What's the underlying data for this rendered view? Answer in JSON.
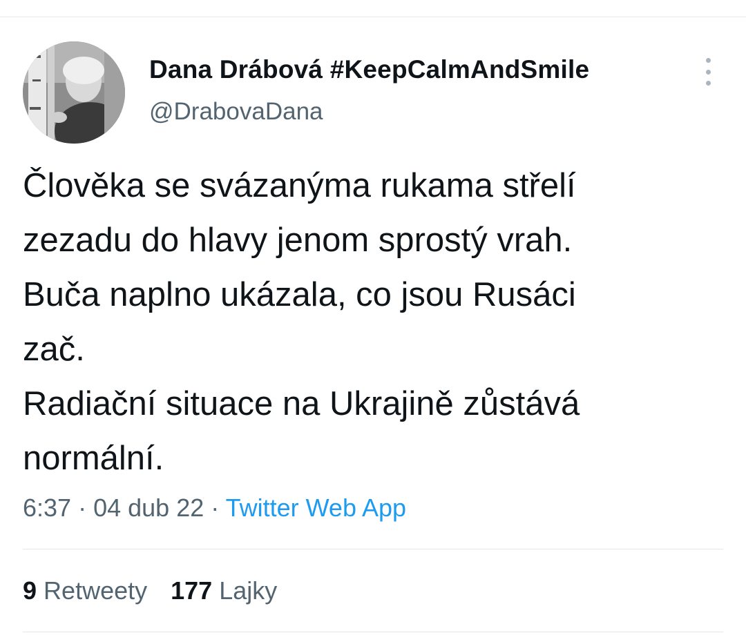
{
  "author": {
    "display_name": "Dana Drábová #KeepCalmAndSmile",
    "handle": "@DrabovaDana",
    "avatar_icon": "profile-photo-avatar"
  },
  "tweet": {
    "lines": [
      "Člověka se svázanýma rukama střelí",
      "zezadu do hlavy jenom sprostý vrah.",
      "Buča naplno ukázala, co jsou Rusáci",
      "zač.",
      "Radiační situace na Ukrajině zůstává",
      "normální."
    ],
    "time": "6:37",
    "separator": " · ",
    "date": "04 dub 22",
    "source": "Twitter Web App"
  },
  "stats": {
    "retweets_count": "9",
    "retweets_label": "Retweety",
    "likes_count": "177",
    "likes_label": "Lajky"
  },
  "colors": {
    "text_primary": "#0f1419",
    "text_secondary": "#536471",
    "accent_link": "#1d9bf0",
    "divider": "#e6e6e6"
  },
  "icons": {
    "more": "more-vertical-icon"
  }
}
